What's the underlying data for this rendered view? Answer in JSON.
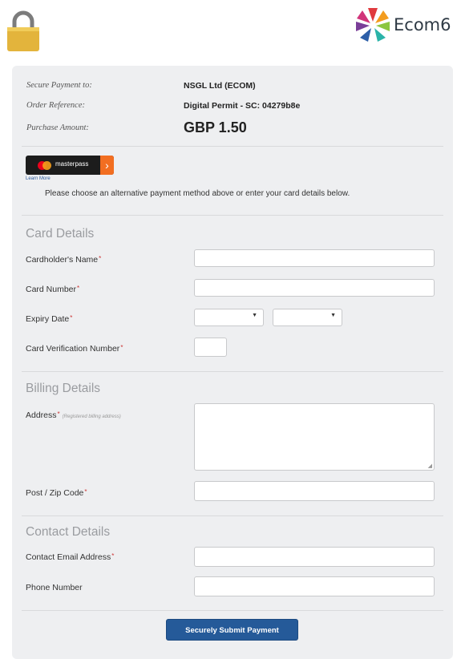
{
  "header": {
    "logo_text": "Ecom6"
  },
  "summary": {
    "payee_label": "Secure Payment to:",
    "payee_value": "NSGL Ltd (ECOM)",
    "reference_label": "Order Reference:",
    "reference_value": "Digital Permit - SC: 04279b8e",
    "amount_label": "Purchase Amount:",
    "amount_value": "GBP 1.50"
  },
  "masterpass": {
    "button_text": "masterpass",
    "learn_more": "Learn More",
    "choose_text": "Please choose an alternative payment method above or enter your card details below."
  },
  "card_section": {
    "title": "Card Details",
    "cardholder_label": "Cardholder's Name",
    "card_number_label": "Card Number",
    "expiry_label": "Expiry Date",
    "cvv_label": "Card Verification Number",
    "required_mark": "*"
  },
  "billing_section": {
    "title": "Billing Details",
    "address_label": "Address",
    "address_hint": "(Registered billing address)",
    "postcode_label": "Post / Zip Code"
  },
  "contact_section": {
    "title": "Contact Details",
    "email_label": "Contact Email Address",
    "phone_label": "Phone Number"
  },
  "submit_label": "Securely Submit Payment",
  "colors": {
    "primary": "#255a99",
    "masterpass_orange": "#f26e21",
    "panel": "#eeeff1"
  }
}
